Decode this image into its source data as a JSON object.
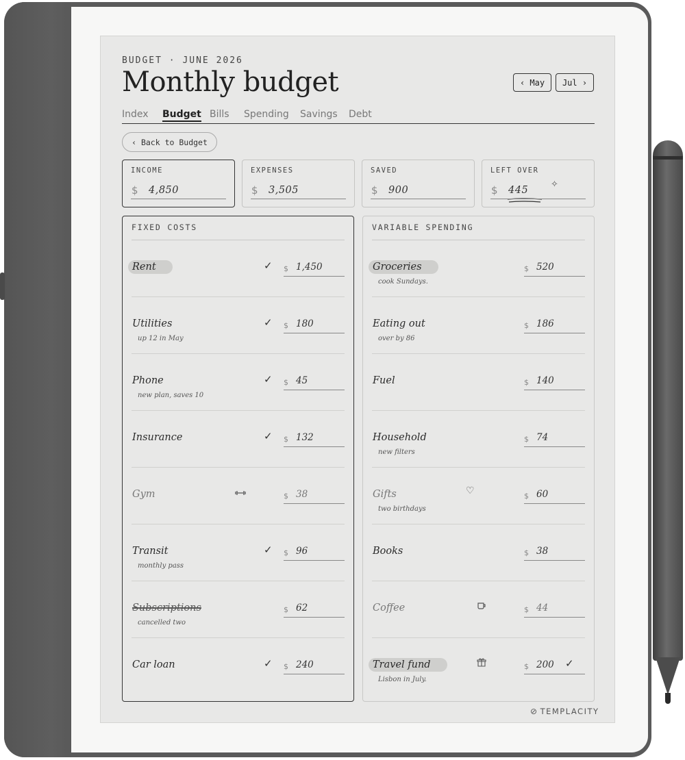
{
  "header": {
    "kicker": "BUDGET · JUNE 2026",
    "title": "Monthly budget",
    "prev_label": "‹ May",
    "next_label": "Jul ›"
  },
  "tabs": [
    {
      "label": "Index",
      "active": false
    },
    {
      "label": "Budget",
      "active": true
    },
    {
      "label": "Bills",
      "active": false
    },
    {
      "label": "Spending",
      "active": false
    },
    {
      "label": "Savings",
      "active": false
    },
    {
      "label": "Debt",
      "active": false
    }
  ],
  "back_label": "‹ Back to Budget",
  "currency": "$",
  "summary": [
    {
      "label": "INCOME",
      "value": "4,850"
    },
    {
      "label": "EXPENSES",
      "value": "3,505"
    },
    {
      "label": "SAVED",
      "value": "900"
    },
    {
      "label": "LEFT OVER",
      "value": "445",
      "icon": "sparkle-icon"
    }
  ],
  "fixed_costs": {
    "heading": "FIXED COSTS",
    "rows": [
      {
        "name": "Rent",
        "note": "",
        "amount": "1,450",
        "paid": true,
        "highlight": true
      },
      {
        "name": "Utilities",
        "note": "up 12 in May",
        "amount": "180",
        "paid": true
      },
      {
        "name": "Phone",
        "note": "new plan, saves 10",
        "amount": "45",
        "paid": true
      },
      {
        "name": "Insurance",
        "note": "",
        "amount": "132",
        "paid": true
      },
      {
        "name": "Gym",
        "note": "",
        "amount": "38",
        "paid": false,
        "icon": "dumbbell-icon",
        "faint": true
      },
      {
        "name": "Transit",
        "note": "monthly pass",
        "amount": "96",
        "paid": true
      },
      {
        "name": "Subscriptions",
        "note": "cancelled two",
        "amount": "62",
        "paid": false,
        "struck": true
      },
      {
        "name": "Car loan",
        "note": "",
        "amount": "240",
        "paid": true
      }
    ]
  },
  "variable_spending": {
    "heading": "VARIABLE SPENDING",
    "rows": [
      {
        "name": "Groceries",
        "note": "cook Sundays.",
        "amount": "520",
        "highlight": true
      },
      {
        "name": "Eating out",
        "note": "over by 86",
        "amount": "186"
      },
      {
        "name": "Fuel",
        "note": "",
        "amount": "140"
      },
      {
        "name": "Household",
        "note": "new filters",
        "amount": "74"
      },
      {
        "name": "Gifts",
        "note": "two birthdays",
        "amount": "60",
        "icon": "heart-icon",
        "faint": true
      },
      {
        "name": "Books",
        "note": "",
        "amount": "38"
      },
      {
        "name": "Coffee",
        "note": "",
        "amount": "44",
        "icon": "coffee-cup-icon",
        "faint": true
      },
      {
        "name": "Travel fund",
        "note": "Lisbon in July.",
        "amount": "200",
        "icon": "gift-icon",
        "highlight": true,
        "checked": true
      }
    ]
  },
  "brand": "TEMPLACITY",
  "colors": {
    "screen": "#e8e8e7",
    "ink": "#2a2a2a",
    "device": "#5a5a5a"
  }
}
